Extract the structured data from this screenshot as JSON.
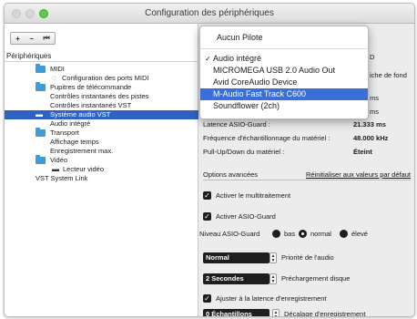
{
  "window": {
    "title": "Configuration des périphériques",
    "toolbar": {
      "add": "+",
      "remove": "−",
      "reset": "⏮"
    }
  },
  "tree": {
    "header": "Périphériques",
    "items": [
      {
        "label": "MIDI",
        "icon": "folder-icon"
      },
      {
        "label": "Configuration des ports MIDI",
        "icon": "midi-port-icon"
      },
      {
        "label": "Pupitres de télécommande",
        "icon": "folder-icon"
      },
      {
        "label": "Contrôles instantanés des pistes",
        "icon": ""
      },
      {
        "label": "Contrôles instantanés VST",
        "icon": ""
      },
      {
        "label": "Système audio VST",
        "icon": "audio-device-icon",
        "selected": true
      },
      {
        "label": "Audio intégré",
        "icon": ""
      },
      {
        "label": "Transport",
        "icon": "folder-icon"
      },
      {
        "label": "Affichage temps",
        "icon": ""
      },
      {
        "label": "Enregistrement max.",
        "icon": ""
      },
      {
        "label": "Vidéo",
        "icon": "folder-icon"
      },
      {
        "label": "Lecteur vidéo",
        "icon": "video-player-icon"
      },
      {
        "label": "VST System Link",
        "icon": ""
      }
    ]
  },
  "details": {
    "partial_1": "D",
    "partial_2": "iche de fond",
    "partial_3": "ms",
    "partial_4": "ms",
    "rows": [
      {
        "key": "Latence ASIO-Guard :",
        "value": "21.333 ms"
      },
      {
        "key": "Fréquence d'échantillonnage du matériel :",
        "value": "48.000 kHz"
      },
      {
        "key": "Pull-Up/Down du matériel :",
        "value": "Éteint"
      }
    ],
    "advanced_label": "Options avancées",
    "reset_link": "Réinitialiser aux valeurs par défaut",
    "multi": {
      "checked": true,
      "label": "Activer le multitraitement"
    },
    "asio_guard": {
      "checked": true,
      "label": "Activer ASIO-Guard"
    },
    "asio_level": {
      "label": "Niveau ASIO-Guard",
      "options": [
        "bas",
        "normal",
        "élevé"
      ],
      "selected": "normal"
    },
    "priority": {
      "value": "Normal",
      "label": "Priorité de l'audio"
    },
    "preload": {
      "value": "2 Secondes",
      "label": "Préchargement disque"
    },
    "adjust_latency": {
      "checked": true,
      "label": "Ajuster à la latence d'enregistrement"
    },
    "offset": {
      "value": "0 Échantillons",
      "label": "Décalage d'enregistrement"
    }
  },
  "driver_menu": {
    "none_label": "Aucun Pilote",
    "items": [
      {
        "label": "Audio intégré",
        "checked": true,
        "highlighted": false
      },
      {
        "label": "MICROMEGA USB 2.0 Audio Out",
        "checked": false,
        "highlighted": false
      },
      {
        "label": "Avid CoreAudio Device",
        "checked": false,
        "highlighted": false
      },
      {
        "label": "M-Audio Fast Track C600",
        "checked": false,
        "highlighted": true
      },
      {
        "label": "Soundflower (2ch)",
        "checked": false,
        "highlighted": false
      }
    ]
  },
  "colors": {
    "selection": "#2f62c2",
    "menu_highlight": "#3a6fd8",
    "folder": "#3f9bd9"
  }
}
